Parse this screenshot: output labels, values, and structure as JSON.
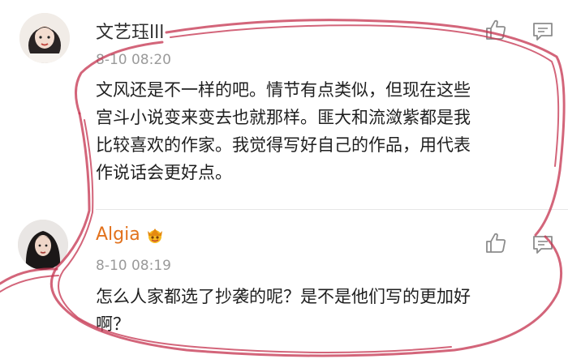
{
  "comments": [
    {
      "username": "文艺珏lll",
      "time": "8-10 08:20",
      "lines": [
        "文风还是不一样的吧。情节有点类似，但现在这些",
        "宫斗小说变来变去也就那样。匪大和流潋紫都是我",
        "比较喜欢的作家。我觉得写好自己的作品，用代表",
        "作说话会更好点。"
      ]
    },
    {
      "username": "Algia",
      "time": "8-10 08:19",
      "lines": [
        "怎么人家都选了抄袭的呢？是不是他们写的更加好",
        "啊？"
      ]
    }
  ],
  "colors": {
    "username_vip": "#e2721d",
    "annotation_ink": "#c4324d"
  }
}
